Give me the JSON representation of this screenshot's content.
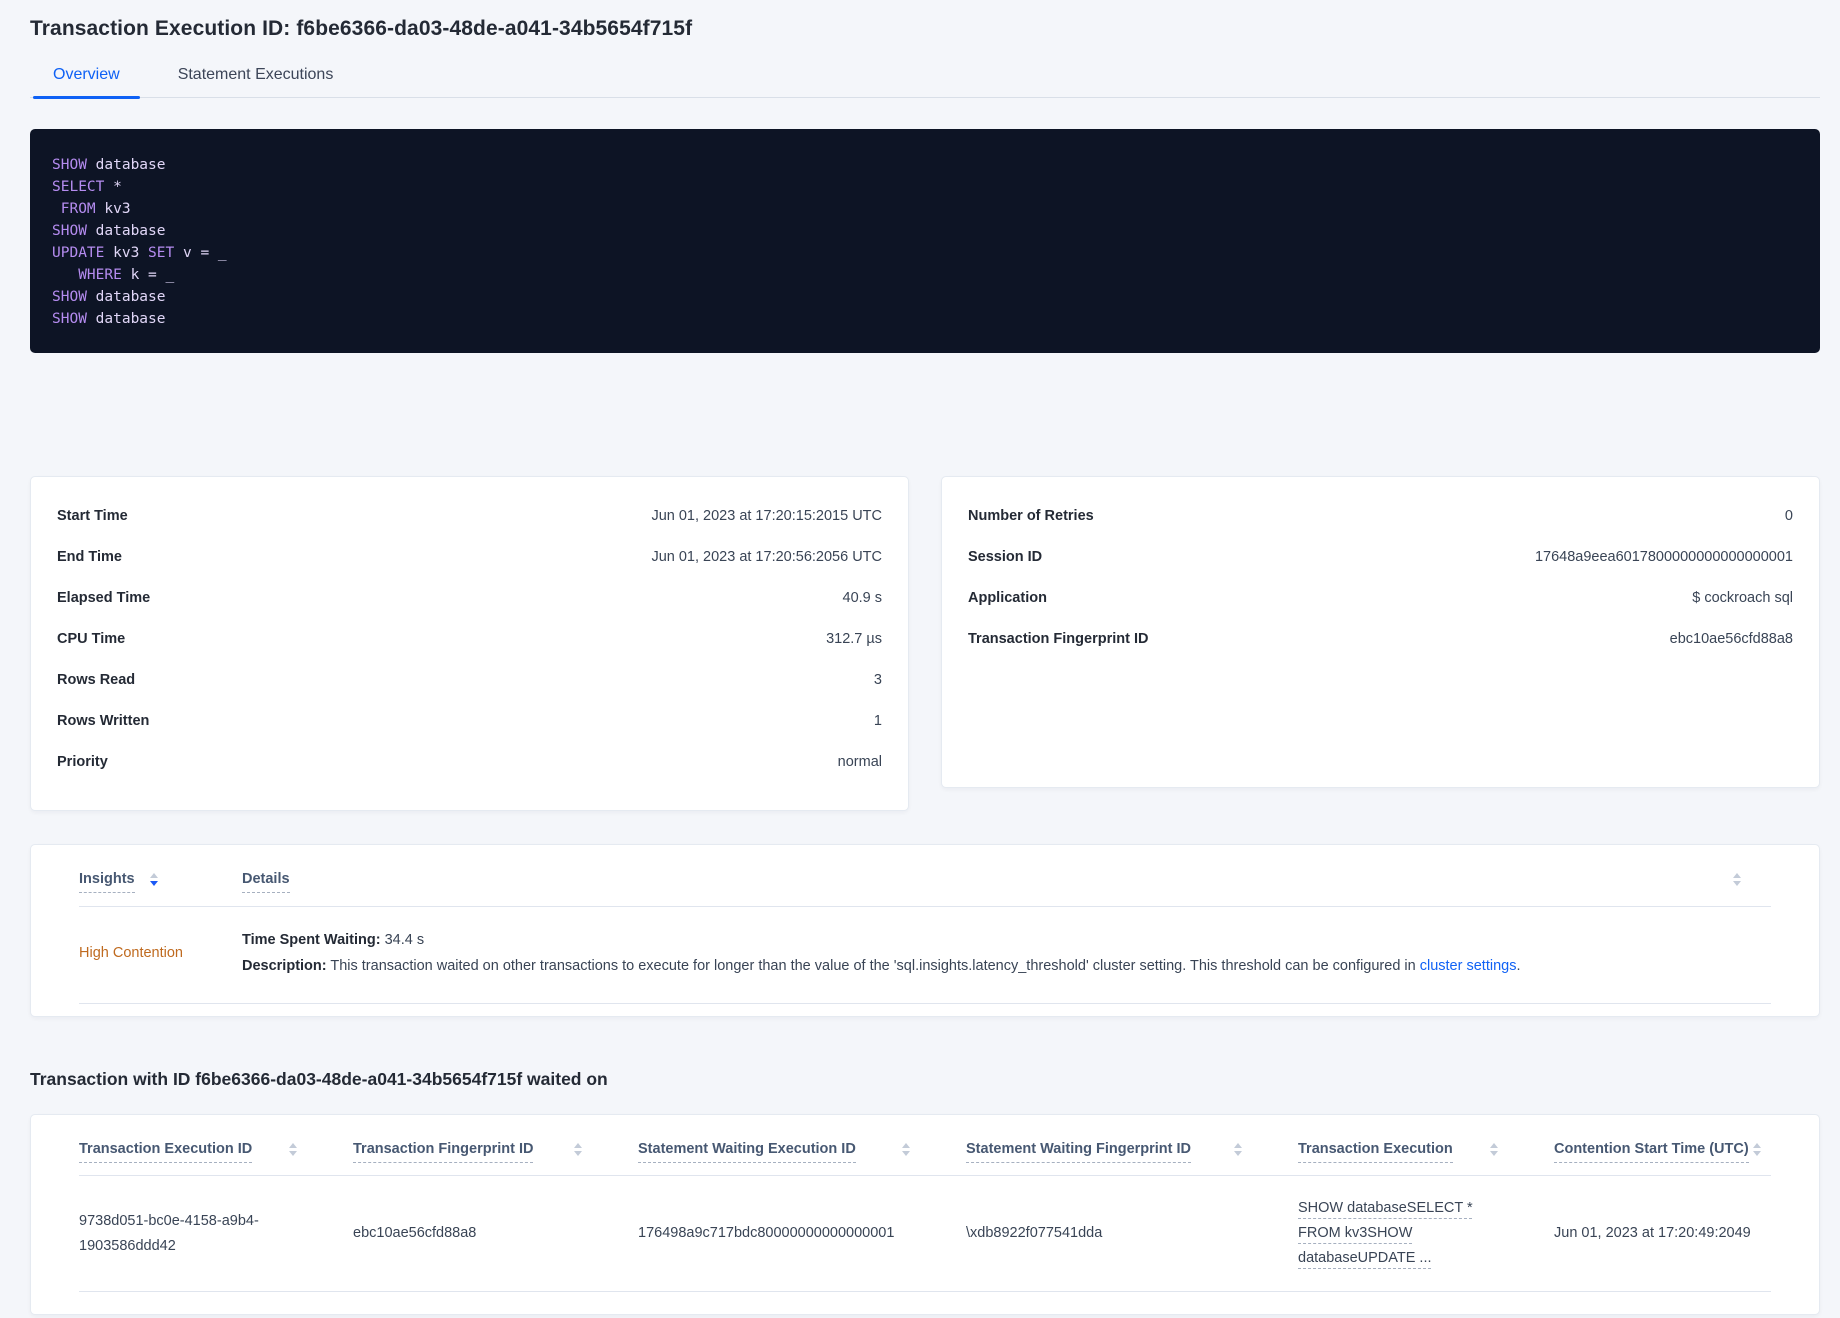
{
  "page": {
    "title": "Transaction Execution ID: f6be6366-da03-48de-a041-34b5654f715f"
  },
  "tabs": [
    {
      "label": "Overview",
      "active": true
    },
    {
      "label": "Statement Executions",
      "active": false
    }
  ],
  "code": {
    "lines": [
      [
        "SHOW",
        " database"
      ],
      [
        "SELECT",
        " *"
      ],
      [
        " ",
        "FROM",
        " kv3"
      ],
      [
        "SHOW",
        " database"
      ],
      [
        "UPDATE",
        " kv3 ",
        "SET",
        " v = _"
      ],
      [
        "   ",
        "WHERE",
        " k = _"
      ],
      [
        "SHOW",
        " database"
      ],
      [
        "SHOW",
        " database"
      ]
    ]
  },
  "summary_left": {
    "rows": [
      {
        "label": "Start Time",
        "value": "Jun 01, 2023 at 17:20:15:2015 UTC"
      },
      {
        "label": "End Time",
        "value": "Jun 01, 2023 at 17:20:56:2056 UTC"
      },
      {
        "label": "Elapsed Time",
        "value": "40.9 s"
      },
      {
        "label": "CPU Time",
        "value": "312.7 µs"
      },
      {
        "label": "Rows Read",
        "value": "3"
      },
      {
        "label": "Rows Written",
        "value": "1"
      },
      {
        "label": "Priority",
        "value": "normal"
      }
    ]
  },
  "summary_right": {
    "rows": [
      {
        "label": "Number of Retries",
        "value": "0"
      },
      {
        "label": "Session ID",
        "value": "17648a9eea6017800000000000000001"
      },
      {
        "label": "Application",
        "value": "$ cockroach sql"
      },
      {
        "label": "Transaction Fingerprint ID",
        "value": "ebc10ae56cfd88a8"
      }
    ]
  },
  "insights_table": {
    "col_insights": "Insights",
    "col_details": "Details",
    "row": {
      "insight": "High Contention",
      "waiting_label": "Time Spent Waiting:",
      "waiting_value": " 34.4 s",
      "desc_label": "Description:",
      "desc_text": " This transaction waited on other transactions to execute for longer than the value of the 'sql.insights.latency_threshold' cluster setting. This threshold can be configured in ",
      "desc_link": "cluster settings",
      "desc_end": "."
    }
  },
  "waited_on": {
    "heading": "Transaction with ID f6be6366-da03-48de-a041-34b5654f715f waited on",
    "columns": [
      "Transaction Execution ID",
      "Transaction Fingerprint ID",
      "Statement Waiting Execution ID",
      "Statement Waiting Fingerprint ID",
      "Transaction Execution",
      "Contention Start Time (UTC)"
    ],
    "row": {
      "transaction_execution_id": "9738d051-bc0e-4158-a9b4-1903586ddd42",
      "transaction_fingerprint_id": "ebc10ae56cfd88a8",
      "statement_waiting_execution_id": "176498a9c717bdc80000000000000001",
      "statement_waiting_fingerprint_id": "\\xdb8922f077541dda",
      "transaction_execution": "SHOW databaseSELECT * FROM kv3SHOW databaseUPDATE ...",
      "contention_start_time": "Jun 01, 2023 at 17:20:49:2049"
    }
  },
  "icons": {
    "sort": "sort-arrows-icon",
    "sort_desc": "sort-arrows-desc-icon"
  },
  "colors": {
    "accent_blue": "#0e61f5",
    "link_blue": "#1062f5",
    "warning_orange": "#bf6a1f",
    "code_background": "#0d1425",
    "code_keyword": "#b58cf0",
    "code_text": "#e0d6f7",
    "page_background": "#f4f6fa"
  }
}
